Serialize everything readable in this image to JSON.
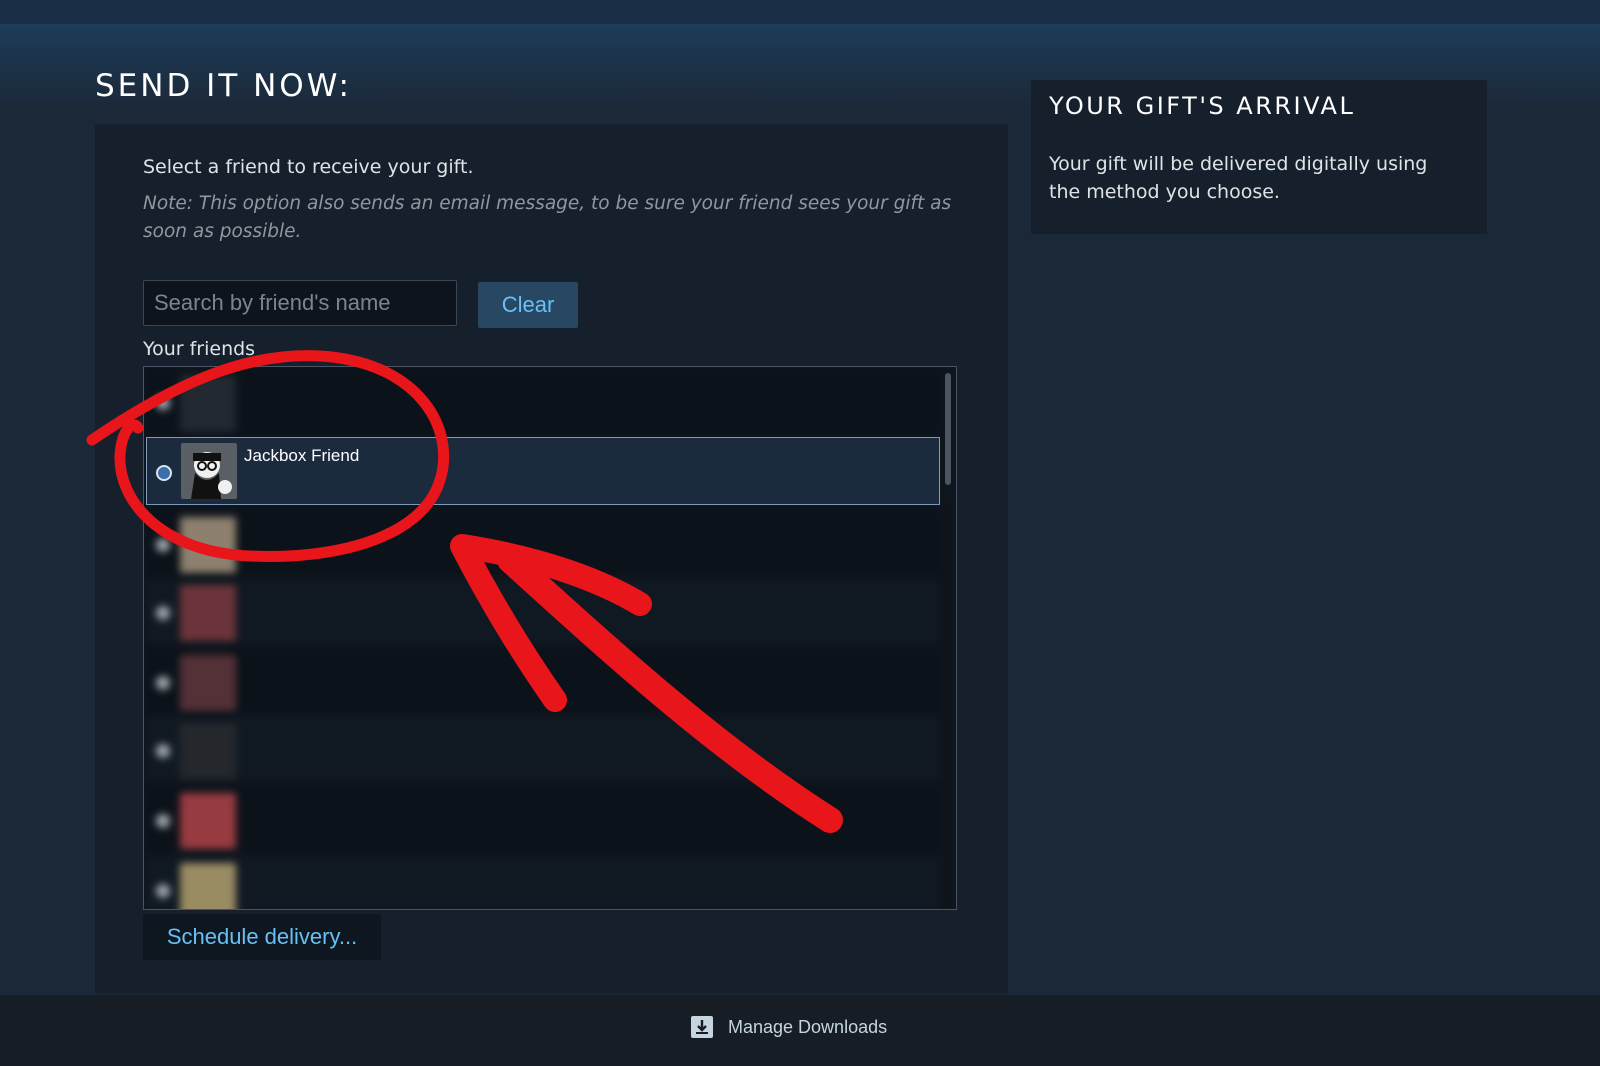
{
  "send": {
    "title": "SEND IT NOW:",
    "instruction": "Select a friend to receive your gift.",
    "note": "Note: This option also sends an email message, to be sure your friend sees your gift as soon as possible.",
    "search_placeholder": "Search by friend's name",
    "clear_label": "Clear",
    "friends_label": "Your friends",
    "friends": [
      {
        "name": "",
        "selected": false,
        "blurred": true
      },
      {
        "name": "Jackbox Friend",
        "selected": true,
        "blurred": false
      },
      {
        "name": "",
        "selected": false,
        "blurred": true
      },
      {
        "name": "",
        "selected": false,
        "blurred": true
      },
      {
        "name": "",
        "selected": false,
        "blurred": true
      },
      {
        "name": "",
        "selected": false,
        "blurred": true
      },
      {
        "name": "",
        "selected": false,
        "blurred": true
      },
      {
        "name": "",
        "selected": false,
        "blurred": true
      }
    ],
    "schedule_label": "Schedule delivery..."
  },
  "gift": {
    "title": "YOUR GIFT'S ARRIVAL",
    "text": "Your gift will be delivered digitally using the method you choose."
  },
  "footer": {
    "manage_downloads": "Manage Downloads"
  },
  "colors": {
    "background": "#1b2838",
    "accent": "#67c1f5",
    "annotation_red": "#e8151b"
  }
}
